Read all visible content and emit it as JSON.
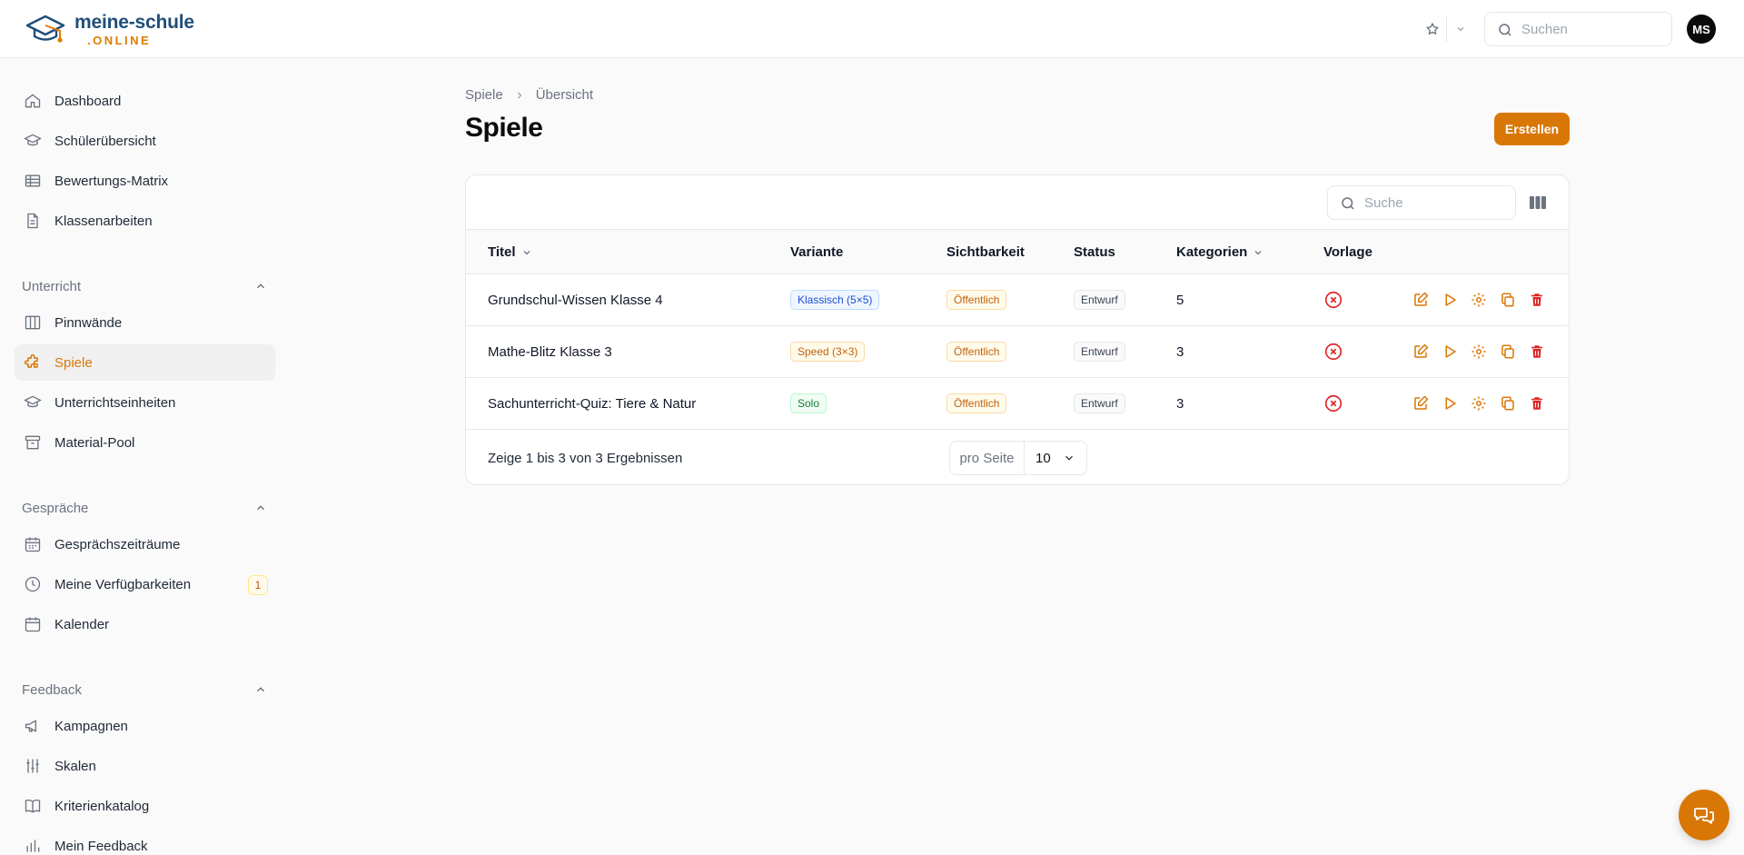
{
  "brand": {
    "name_line1": "meine-schule",
    "name_line2": ".ONLINE"
  },
  "topbar": {
    "search_placeholder": "Suchen",
    "avatar_initials": "MS"
  },
  "sidebar": {
    "items_main": [
      {
        "label": "Dashboard",
        "icon": "home-icon"
      },
      {
        "label": "Schülerübersicht",
        "icon": "graduation-cap-icon"
      },
      {
        "label": "Bewertungs-Matrix",
        "icon": "table-icon"
      },
      {
        "label": "Klassenarbeiten",
        "icon": "document-icon"
      }
    ],
    "groups": [
      {
        "label": "Unterricht",
        "items": [
          {
            "label": "Pinnwände",
            "icon": "columns-icon"
          },
          {
            "label": "Spiele",
            "icon": "puzzle-icon",
            "active": true
          },
          {
            "label": "Unterrichtseinheiten",
            "icon": "graduation-cap-icon"
          },
          {
            "label": "Material-Pool",
            "icon": "archive-icon"
          }
        ]
      },
      {
        "label": "Gespräche",
        "items": [
          {
            "label": "Gesprächszeiträume",
            "icon": "calendar-range-icon"
          },
          {
            "label": "Meine Verfügbarkeiten",
            "icon": "clock-icon",
            "badge": "1"
          },
          {
            "label": "Kalender",
            "icon": "calendar-icon"
          }
        ]
      },
      {
        "label": "Feedback",
        "items": [
          {
            "label": "Kampagnen",
            "icon": "megaphone-icon"
          },
          {
            "label": "Skalen",
            "icon": "sliders-icon"
          },
          {
            "label": "Kriterienkatalog",
            "icon": "book-icon"
          },
          {
            "label": "Mein Feedback",
            "icon": "bar-chart-icon"
          }
        ]
      }
    ]
  },
  "breadcrumb": {
    "root": "Spiele",
    "current": "Übersicht"
  },
  "page": {
    "title": "Spiele",
    "create_label": "Erstellen"
  },
  "table": {
    "search_placeholder": "Suche",
    "columns": [
      "Titel",
      "Variante",
      "Sichtbarkeit",
      "Status",
      "Kategorien",
      "Vorlage"
    ],
    "rows": [
      {
        "title": "Grundschul-Wissen Klasse 4",
        "variant": "Klassisch (5×5)",
        "variant_color": "blue",
        "visibility": "Öffentlich",
        "status": "Entwurf",
        "categories": "5"
      },
      {
        "title": "Mathe-Blitz Klasse 3",
        "variant": "Speed (3×3)",
        "variant_color": "amber",
        "visibility": "Öffentlich",
        "status": "Entwurf",
        "categories": "3"
      },
      {
        "title": "Sachunterricht-Quiz: Tiere & Natur",
        "variant": "Solo",
        "variant_color": "green",
        "visibility": "Öffentlich",
        "status": "Entwurf",
        "categories": "3"
      }
    ],
    "footer": {
      "results": "Zeige 1 bis 3 von 3 Ergebnissen",
      "per_page_label": "pro Seite",
      "per_page_value": "10"
    }
  },
  "colors": {
    "accent": "#d97706",
    "brand_blue": "#1f4e79",
    "danger": "#dc2626"
  }
}
